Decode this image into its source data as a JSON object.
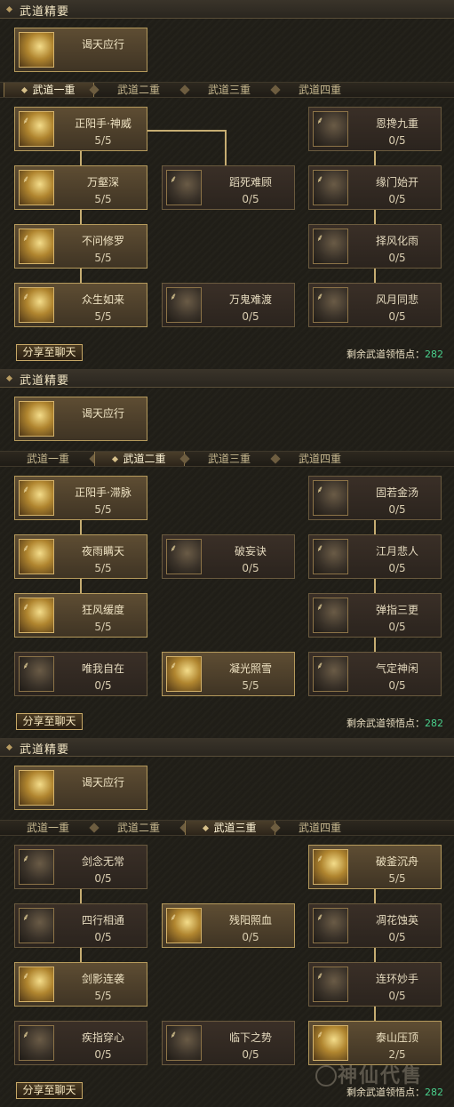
{
  "panels": [
    {
      "section_title": "武道精要",
      "essence": {
        "name": "谒天应行"
      },
      "tabs": [
        "武道一重",
        "武道二重",
        "武道三重",
        "武道四重"
      ],
      "active_tab": 0,
      "nodes": [
        {
          "name": "正阳手·神威",
          "level": "5/5",
          "active": true
        },
        {
          "name": "恩搀九重",
          "level": "0/5",
          "active": false
        },
        {
          "name": "万壑深",
          "level": "5/5",
          "active": true
        },
        {
          "name": "蹈死难顾",
          "level": "0/5",
          "active": false
        },
        {
          "name": "缘门始开",
          "level": "0/5",
          "active": false
        },
        {
          "name": "不问修罗",
          "level": "5/5",
          "active": true
        },
        {
          "name": "择风化雨",
          "level": "0/5",
          "active": false
        },
        {
          "name": "众生如来",
          "level": "5/5",
          "active": true
        },
        {
          "name": "万鬼难渡",
          "level": "0/5",
          "active": false
        },
        {
          "name": "风月同悲",
          "level": "0/5",
          "active": false
        }
      ],
      "share_label": "分享至聊天",
      "remain_label": "剩余武道领悟点：",
      "remain_value": "282"
    },
    {
      "section_title": "武道精要",
      "essence": {
        "name": "谒天应行"
      },
      "tabs": [
        "武道一重",
        "武道二重",
        "武道三重",
        "武道四重"
      ],
      "active_tab": 1,
      "nodes": [
        {
          "name": "正阳手·滞脉",
          "level": "5/5",
          "active": true
        },
        {
          "name": "固若金汤",
          "level": "0/5",
          "active": false
        },
        {
          "name": "夜雨瞒天",
          "level": "5/5",
          "active": true
        },
        {
          "name": "破妄诀",
          "level": "0/5",
          "active": false
        },
        {
          "name": "江月悲人",
          "level": "0/5",
          "active": false
        },
        {
          "name": "狂风缓度",
          "level": "5/5",
          "active": true
        },
        {
          "name": "弹指三更",
          "level": "0/5",
          "active": false
        },
        {
          "name": "唯我自在",
          "level": "0/5",
          "active": false
        },
        {
          "name": "凝光照雪",
          "level": "5/5",
          "active": true
        },
        {
          "name": "气定神闲",
          "level": "0/5",
          "active": false
        }
      ],
      "share_label": "分享至聊天",
      "remain_label": "剩余武道领悟点：",
      "remain_value": "282"
    },
    {
      "section_title": "武道精要",
      "essence": {
        "name": "谒天应行"
      },
      "tabs": [
        "武道一重",
        "武道二重",
        "武道三重",
        "武道四重"
      ],
      "active_tab": 2,
      "nodes": [
        {
          "name": "剑念无常",
          "level": "0/5",
          "active": false
        },
        {
          "name": "破釜沉舟",
          "level": "5/5",
          "active": true
        },
        {
          "name": "四行相通",
          "level": "0/5",
          "active": false
        },
        {
          "name": "残阳照血",
          "level": "0/5",
          "active": true
        },
        {
          "name": "凋花蚀英",
          "level": "0/5",
          "active": false
        },
        {
          "name": "剑影连袭",
          "level": "5/5",
          "active": true
        },
        {
          "name": "连环妙手",
          "level": "0/5",
          "active": false
        },
        {
          "name": "疾指穿心",
          "level": "0/5",
          "active": false
        },
        {
          "name": "临下之势",
          "level": "0/5",
          "active": false
        },
        {
          "name": "泰山压顶",
          "level": "2/5",
          "active": true
        }
      ],
      "share_label": "分享至聊天",
      "remain_label": "剩余武道领悟点：",
      "remain_value": "282"
    }
  ],
  "watermark": "神仙代售"
}
